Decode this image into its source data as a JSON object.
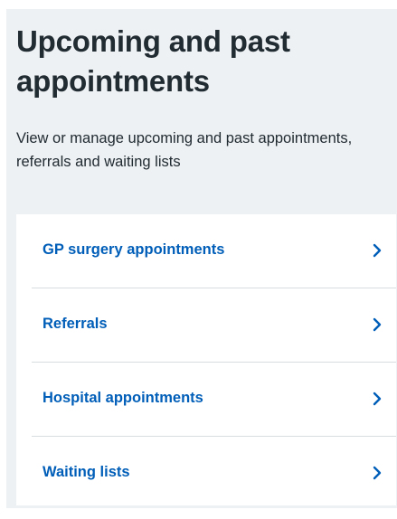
{
  "page": {
    "title": "Upcoming and past appointments",
    "description": "View or manage upcoming and past appointments, referrals and waiting lists"
  },
  "menu": {
    "items": [
      {
        "label": "GP surgery appointments",
        "icon": "chevron-right-icon"
      },
      {
        "label": "Referrals",
        "icon": "chevron-right-icon"
      },
      {
        "label": "Hospital appointments",
        "icon": "chevron-right-icon"
      },
      {
        "label": "Waiting lists",
        "icon": "chevron-right-icon"
      }
    ]
  },
  "colors": {
    "link": "#005eb8",
    "text": "#212b32",
    "panel_background": "#eef1f3",
    "card_background": "#ffffff",
    "divider": "#d8dde0"
  }
}
